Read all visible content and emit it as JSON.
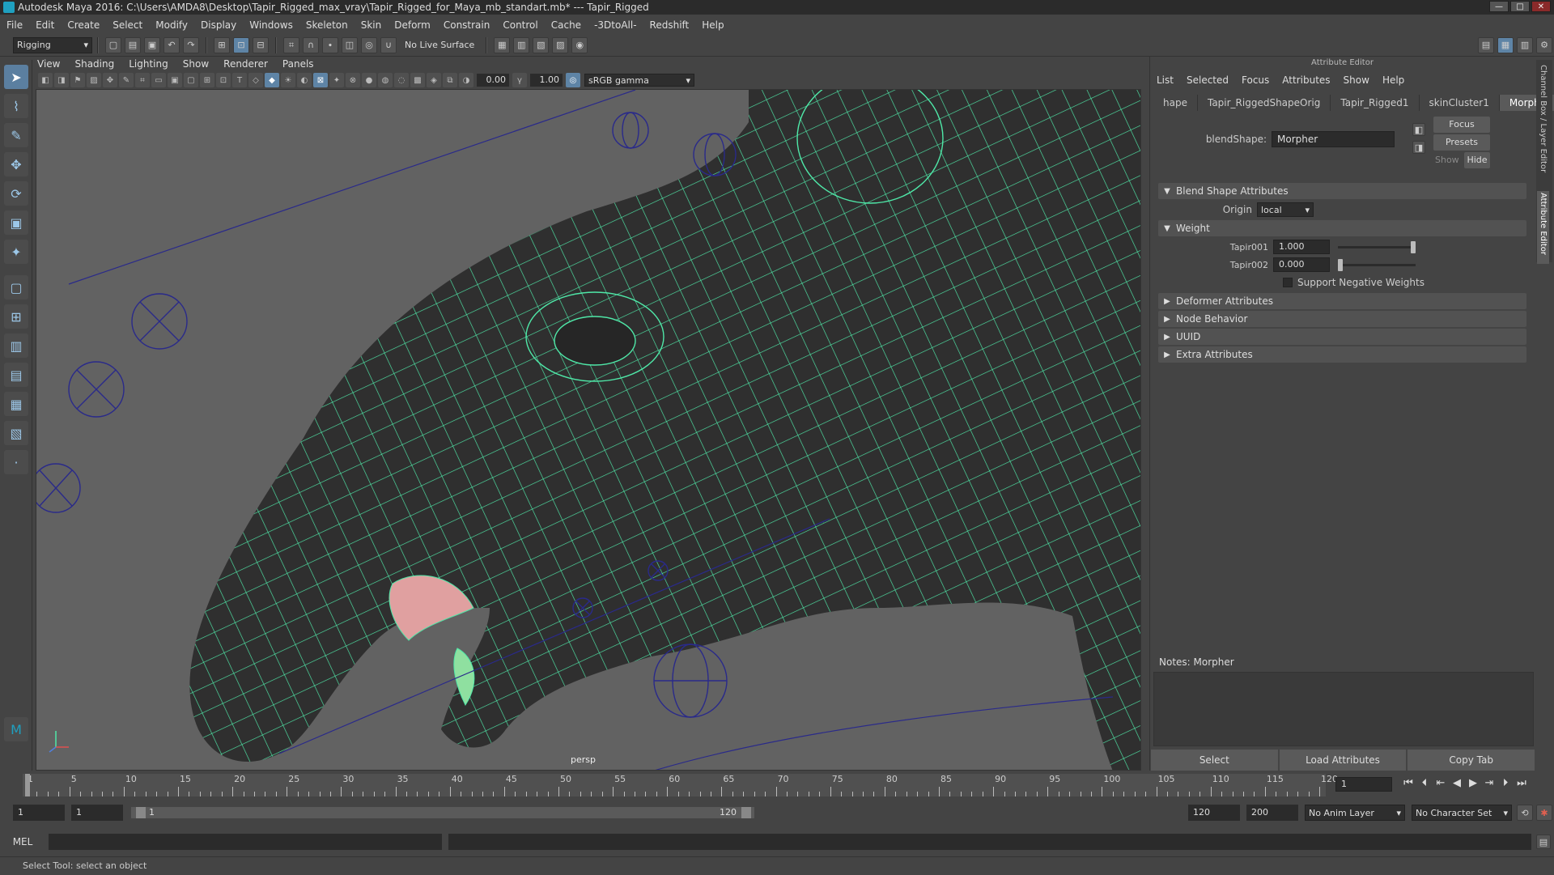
{
  "window": {
    "title": "Autodesk Maya 2016: C:\\Users\\AMDA8\\Desktop\\Tapir_Rigged_max_vray\\Tapir_Rigged_for_Maya_mb_standart.mb*   ---   Tapir_Rigged"
  },
  "menubar": [
    "File",
    "Edit",
    "Create",
    "Select",
    "Modify",
    "Display",
    "Windows",
    "Skeleton",
    "Skin",
    "Deform",
    "Constrain",
    "Control",
    "Cache",
    "-3DtoAll-",
    "Redshift",
    "Help"
  ],
  "shelf": {
    "mode": "Rigging",
    "live_surface": "No Live Surface"
  },
  "viewport": {
    "menu": [
      "View",
      "Shading",
      "Lighting",
      "Show",
      "Renderer",
      "Panels"
    ],
    "exposure": "0.00",
    "gamma": "1.00",
    "color_space": "sRGB gamma",
    "camera": "persp"
  },
  "attribute_editor": {
    "title": "Attribute Editor",
    "menu": [
      "List",
      "Selected",
      "Focus",
      "Attributes",
      "Show",
      "Help"
    ],
    "tabs": [
      "hape",
      "Tapir_RiggedShapeOrig",
      "Tapir_Rigged1",
      "skinCluster1",
      "Morpher"
    ],
    "active_tab": "Morpher",
    "blendshape_label": "blendShape:",
    "blendshape_value": "Morpher",
    "focus_btn": "Focus",
    "presets_btn": "Presets",
    "show_label": "Show",
    "hide_btn": "Hide",
    "sections": {
      "blend_shape": "Blend Shape Attributes",
      "origin_label": "Origin",
      "origin_value": "local",
      "weight": "Weight",
      "weights": [
        {
          "name": "Tapir001",
          "value": "1.000",
          "fraction": 1.0
        },
        {
          "name": "Tapir002",
          "value": "0.000",
          "fraction": 0.0
        }
      ],
      "support_negative": "Support Negative Weights",
      "collapsed": [
        "Deformer Attributes",
        "Node Behavior",
        "UUID",
        "Extra Attributes"
      ]
    },
    "notes_label": "Notes:  Morpher",
    "buttons": [
      "Select",
      "Load Attributes",
      "Copy Tab"
    ],
    "side_tabs": [
      "Channel Box / Layer Editor",
      "Attribute Editor"
    ]
  },
  "timeline": {
    "ticks": [
      "1",
      "5",
      "10",
      "15",
      "20",
      "25",
      "30",
      "35",
      "40",
      "45",
      "50",
      "55",
      "60",
      "65",
      "70",
      "75",
      "80",
      "85",
      "90",
      "95",
      "100",
      "105",
      "110",
      "115",
      "120"
    ],
    "current_frame": "1",
    "range_start": "1",
    "playback_start": "1",
    "range_slider_start": "1",
    "range_slider_end": "120",
    "playback_end": "120",
    "range_end": "200",
    "anim_layer": "No Anim Layer",
    "character_set": "No Character Set"
  },
  "mel": {
    "label": "MEL"
  },
  "status": "Select Tool: select an object"
}
